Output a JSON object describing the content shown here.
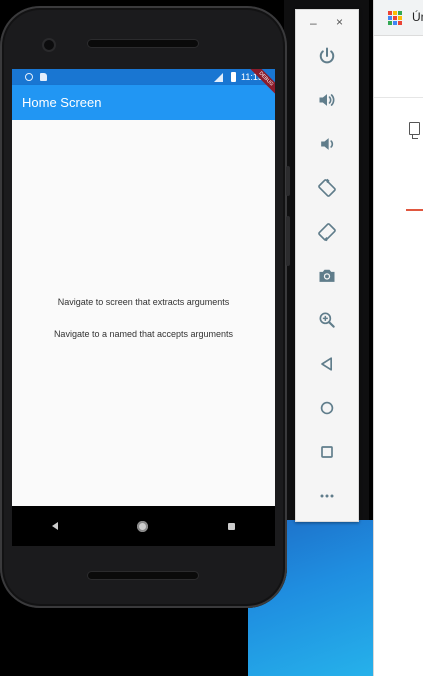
{
  "background_window": {
    "tab_text": "Ún"
  },
  "phone": {
    "status_bar": {
      "time": "11:15"
    },
    "app_bar": {
      "title": "Home Screen",
      "debug_banner": "DEBUG"
    },
    "buttons": [
      {
        "label": "Navigate to screen that extracts arguments"
      },
      {
        "label": "Navigate to a named that accepts arguments"
      }
    ]
  },
  "emulator_toolbar": {
    "minimize_label": "–",
    "close_label": "×",
    "controls": [
      "power-icon",
      "volume-up-icon",
      "volume-down-icon",
      "rotate-left-icon",
      "rotate-right-icon",
      "camera-icon",
      "zoom-icon",
      "back-icon",
      "home-icon",
      "overview-icon",
      "more-icon"
    ]
  },
  "colors": {
    "app_bar": "#2196f3",
    "status_bar": "#1976d2",
    "toolbar_icon": "#607d8b"
  }
}
